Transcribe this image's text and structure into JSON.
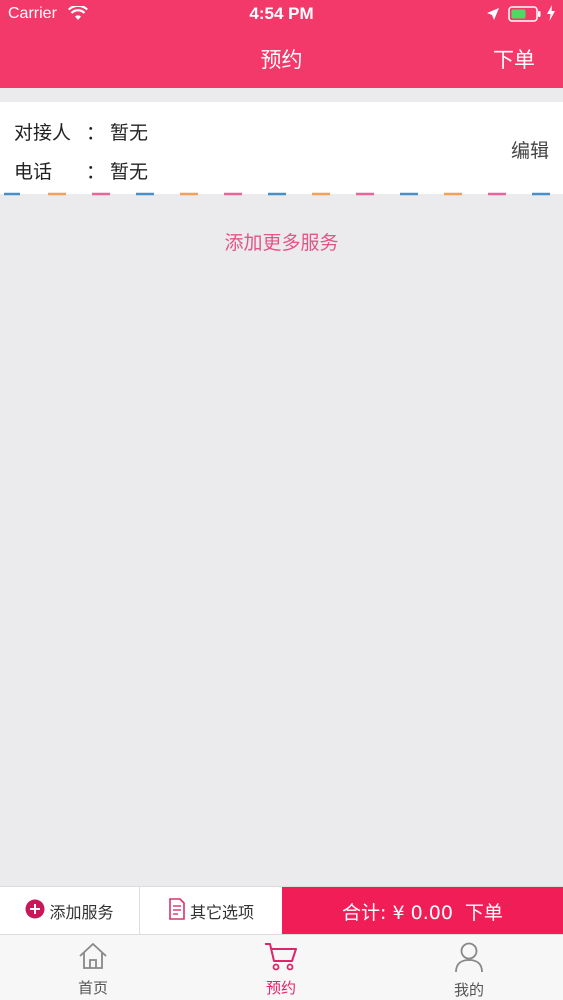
{
  "status_bar": {
    "carrier": "Carrier",
    "time": "4:54 PM"
  },
  "nav": {
    "title": "预约",
    "order_label": "下单"
  },
  "contact": {
    "contact_label": "对接人",
    "contact_value": "暂无",
    "phone_label": "电话",
    "phone_value": "暂无",
    "separator": "：",
    "edit_label": "编辑"
  },
  "add_more_label": "添加更多服务",
  "action_bar": {
    "add_service_label": "添加服务",
    "other_options_label": "其它选项",
    "total_label": "合计: ¥ 0.00",
    "order_label": "下单"
  },
  "tabs": [
    {
      "label": "首页",
      "icon": "home-icon"
    },
    {
      "label": "预约",
      "icon": "cart-icon",
      "active": true
    },
    {
      "label": "我的",
      "icon": "user-icon"
    }
  ],
  "colors": {
    "brand": "#f2396a",
    "total_bg": "#f01d57",
    "accent_text": "#e25687",
    "active_tab": "#e0246a"
  }
}
